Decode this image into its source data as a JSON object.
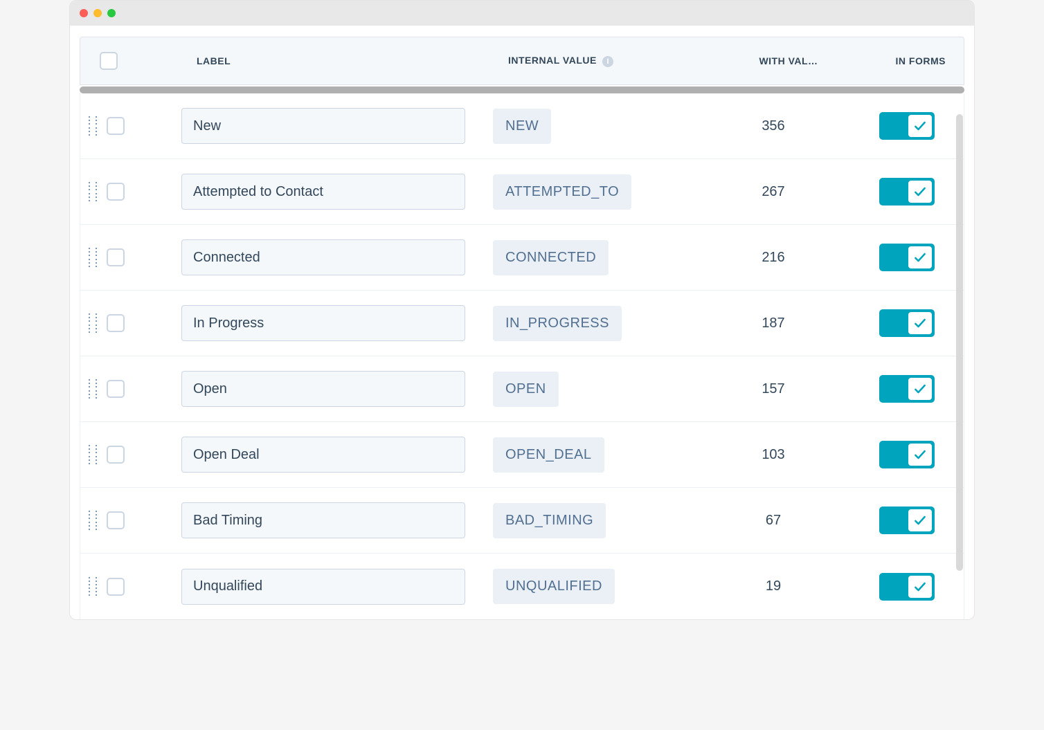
{
  "columns": {
    "label": "LABEL",
    "internal_value": "INTERNAL VALUE",
    "with_value": "WITH VAL…",
    "in_forms": "IN FORMS"
  },
  "rows": [
    {
      "label": "New",
      "internal": "NEW",
      "count": "356",
      "in_forms": true
    },
    {
      "label": "Attempted to Contact",
      "internal": "ATTEMPTED_TO",
      "count": "267",
      "in_forms": true
    },
    {
      "label": "Connected",
      "internal": "CONNECTED",
      "count": "216",
      "in_forms": true
    },
    {
      "label": "In Progress",
      "internal": "IN_PROGRESS",
      "count": "187",
      "in_forms": true
    },
    {
      "label": "Open",
      "internal": "OPEN",
      "count": "157",
      "in_forms": true
    },
    {
      "label": "Open Deal",
      "internal": "OPEN_DEAL",
      "count": "103",
      "in_forms": true
    },
    {
      "label": "Bad Timing",
      "internal": "BAD_TIMING",
      "count": "67",
      "in_forms": true
    },
    {
      "label": "Unqualified",
      "internal": "UNQUALIFIED",
      "count": "19",
      "in_forms": true
    }
  ]
}
